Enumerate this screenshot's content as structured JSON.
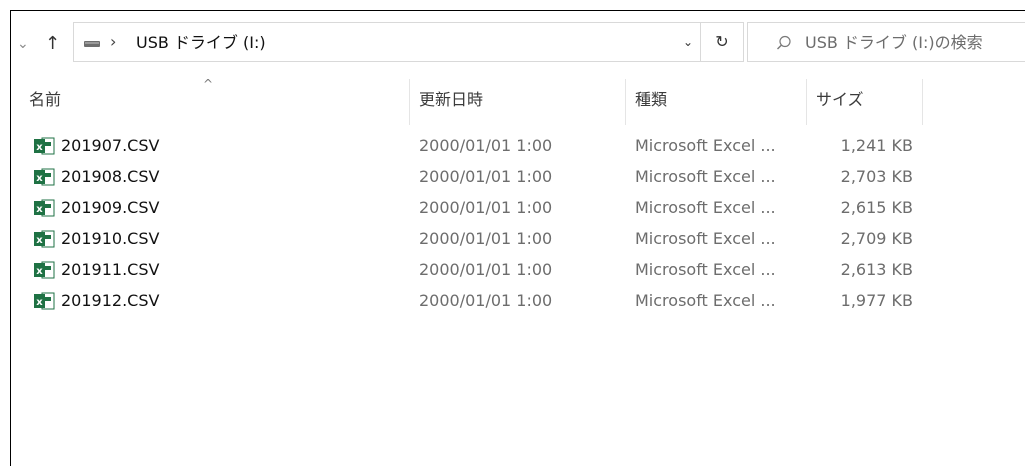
{
  "window": {
    "title": "USB ドライブ (I:)"
  },
  "nav": {
    "back_glyph": "⌄",
    "up_glyph": "↑"
  },
  "address": {
    "separator": "›",
    "path": "USB ドライブ (I:)",
    "dropdown": "⌄",
    "refresh": "↻"
  },
  "search": {
    "placeholder": "USB ドライブ (I:)の検索"
  },
  "columns": {
    "name": "名前",
    "modified": "更新日時",
    "type": "種類",
    "size": "サイズ",
    "sort_indicator": "^"
  },
  "files": [
    {
      "name": "201907.CSV",
      "modified": "2000/01/01 1:00",
      "type": "Microsoft Excel ...",
      "size": "1,241 KB"
    },
    {
      "name": "201908.CSV",
      "modified": "2000/01/01 1:00",
      "type": "Microsoft Excel ...",
      "size": "2,703 KB"
    },
    {
      "name": "201909.CSV",
      "modified": "2000/01/01 1:00",
      "type": "Microsoft Excel ...",
      "size": "2,615 KB"
    },
    {
      "name": "201910.CSV",
      "modified": "2000/01/01 1:00",
      "type": "Microsoft Excel ...",
      "size": "2,709 KB"
    },
    {
      "name": "201911.CSV",
      "modified": "2000/01/01 1:00",
      "type": "Microsoft Excel ...",
      "size": "2,613 KB"
    },
    {
      "name": "201912.CSV",
      "modified": "2000/01/01 1:00",
      "type": "Microsoft Excel ...",
      "size": "1,977 KB"
    }
  ],
  "colors": {
    "excel_green": "#1f7244",
    "border": "#d9d9d9",
    "secondary_text": "#6d6d6d"
  }
}
